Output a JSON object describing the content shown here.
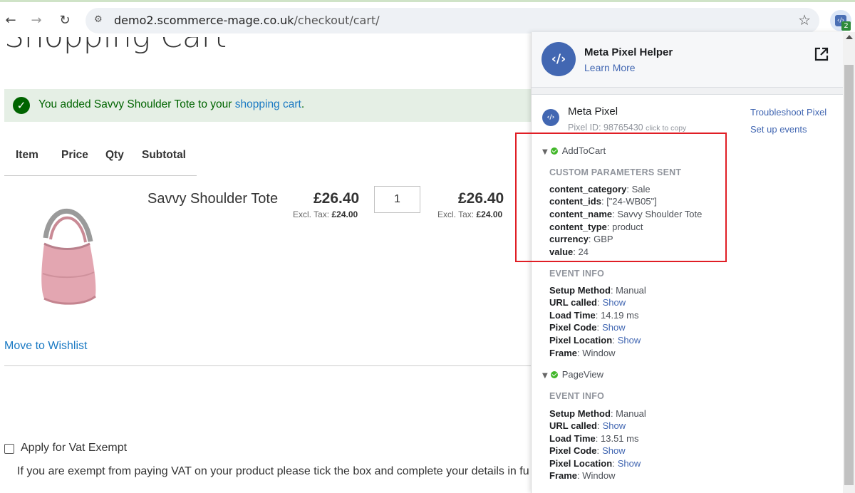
{
  "browser": {
    "url_domain": "demo2.scommerce-mage.co.uk",
    "url_path": "/checkout/cart/",
    "extension_badge": "2"
  },
  "page": {
    "title": "Shopping Cart",
    "message": {
      "prefix": "You added Savvy Shoulder Tote to your ",
      "link": "shopping cart",
      "suffix": "."
    },
    "columns": [
      "Item",
      "Price",
      "Qty",
      "Subtotal"
    ],
    "item": {
      "name": "Savvy Shoulder Tote",
      "price": "£26.40",
      "price_excl_label": "Excl. Tax:",
      "price_excl": "£24.00",
      "qty": "1",
      "subtotal": "£26.40",
      "subtotal_excl_label": "Excl. Tax:",
      "subtotal_excl": "£24.00"
    },
    "wishlist_link": "Move to Wishlist",
    "vat": {
      "label": "Apply for Vat Exempt",
      "note": "If you are exempt from paying VAT on your product please tick the box and complete your details in fu"
    }
  },
  "popup": {
    "title": "Meta Pixel Helper",
    "learn_more": "Learn More",
    "pixel_title": "Meta Pixel",
    "pixel_id": "Pixel ID: 98765430",
    "click_to_copy": "click to copy",
    "troubleshoot": "Troubleshoot Pixel",
    "setup_events": "Set up events",
    "add_to_cart": {
      "name": "AddToCart",
      "custom_title": "CUSTOM PARAMETERS SENT",
      "params": [
        {
          "k": "content_category",
          "v": ": Sale"
        },
        {
          "k": "content_ids",
          "v": ": [\"24-WB05\"]"
        },
        {
          "k": "content_name",
          "v": ": Savvy Shoulder Tote"
        },
        {
          "k": "content_type",
          "v": ": product"
        },
        {
          "k": "currency",
          "v": ": GBP"
        },
        {
          "k": "value",
          "v": ": 24"
        }
      ],
      "event_info_title": "EVENT INFO",
      "info": [
        {
          "k": "Setup Method",
          "v": ": Manual"
        },
        {
          "k": "URL called",
          "v": ":",
          "link": "Show"
        },
        {
          "k": "Load Time",
          "v": ": 14.19 ms"
        },
        {
          "k": "Pixel Code",
          "v": ":",
          "link": "Show"
        },
        {
          "k": "Pixel Location",
          "v": ":",
          "link": "Show"
        },
        {
          "k": "Frame",
          "v": ": Window"
        }
      ]
    },
    "page_view": {
      "name": "PageView",
      "event_info_title": "EVENT INFO",
      "info": [
        {
          "k": "Setup Method",
          "v": ": Manual"
        },
        {
          "k": "URL called",
          "v": ":",
          "link": "Show"
        },
        {
          "k": "Load Time",
          "v": ": 13.51 ms"
        },
        {
          "k": "Pixel Code",
          "v": ":",
          "link": "Show"
        },
        {
          "k": "Pixel Location",
          "v": ":",
          "link": "Show"
        },
        {
          "k": "Frame",
          "v": ": Window"
        }
      ]
    }
  }
}
